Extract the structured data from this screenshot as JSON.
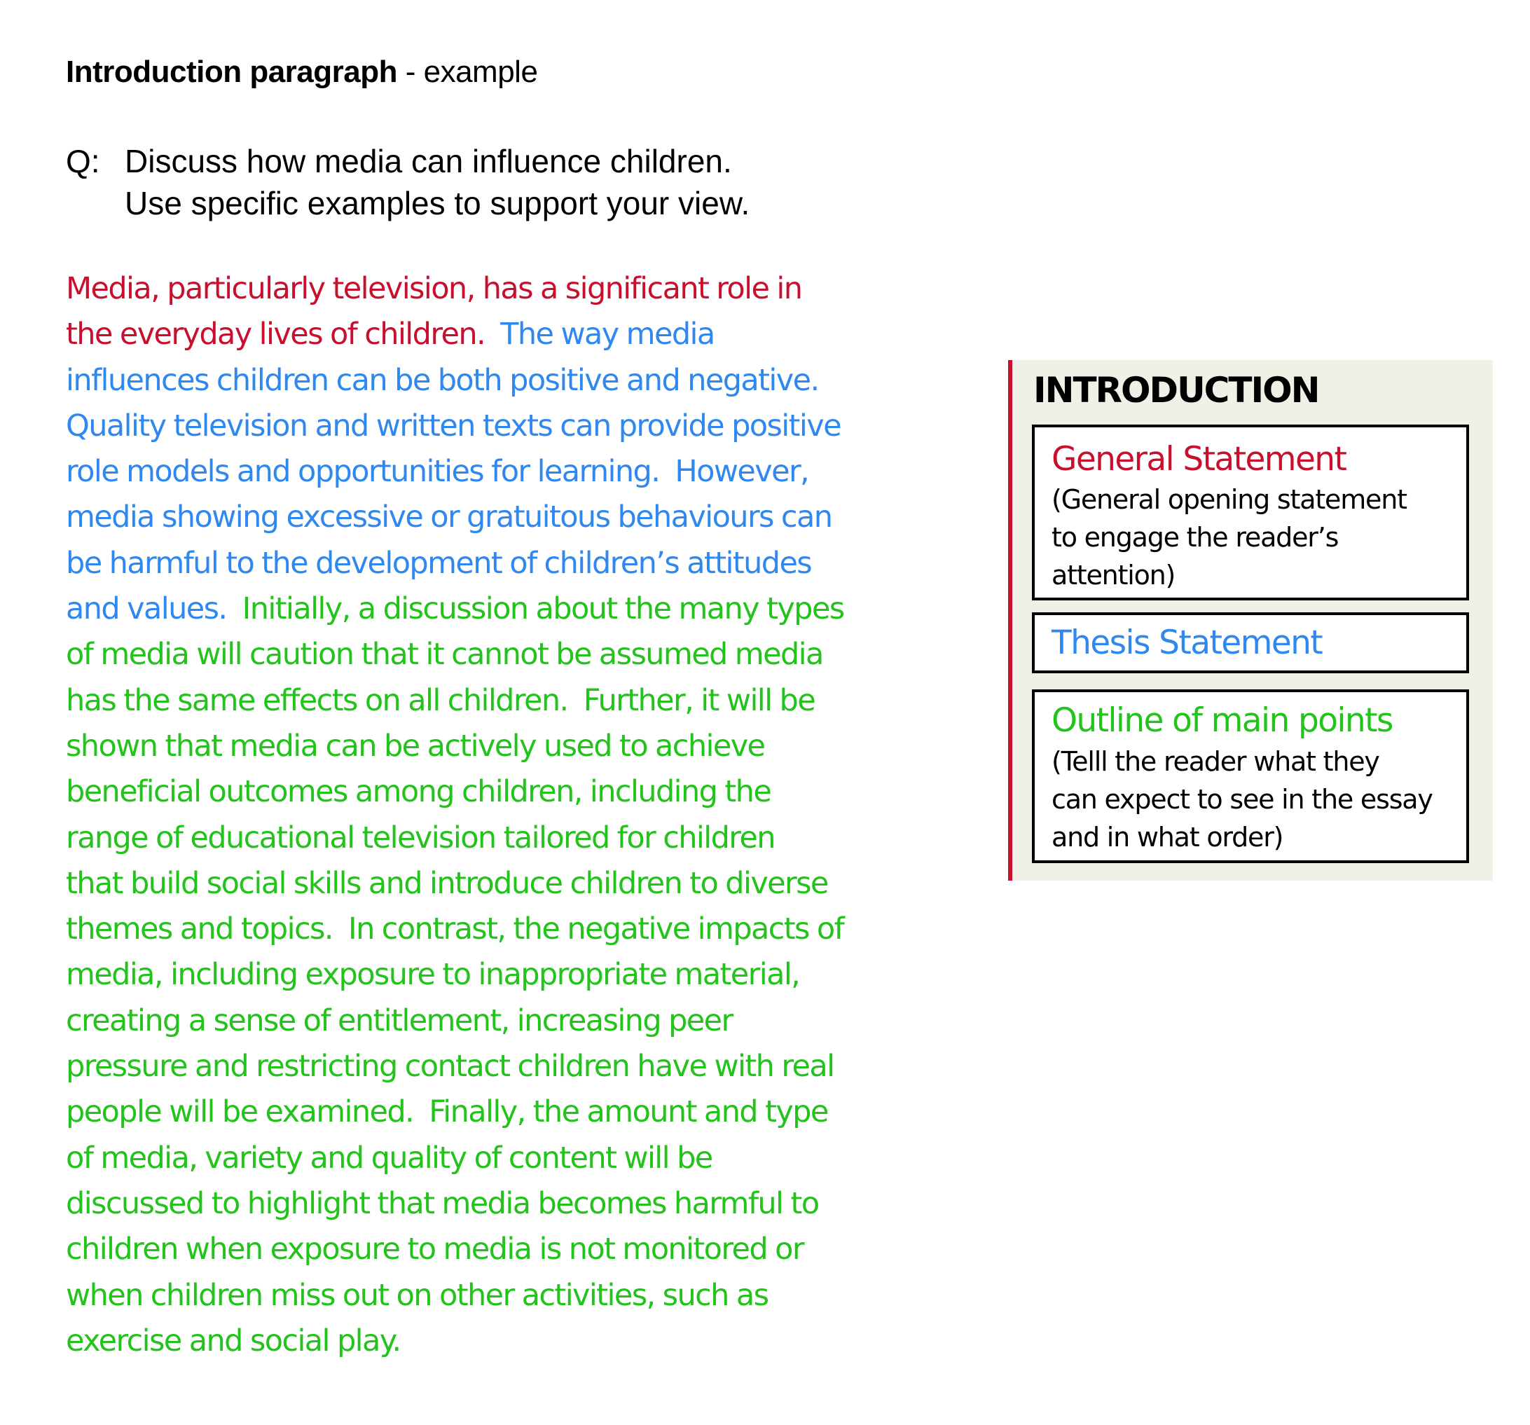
{
  "header": {
    "title_bold": "Introduction paragraph",
    "title_rest": " - example"
  },
  "question": {
    "label": "Q:",
    "line1": "Discuss how media can influence children.",
    "line2": "Use specific examples to support your view."
  },
  "colors": {
    "general_statement": "#c8102e",
    "thesis_statement": "#2f87f0",
    "outline": "#22c31a",
    "panel_background": "#eff1e7",
    "panel_accent_bar": "#c8102e"
  },
  "paragraph": {
    "lines": [
      [
        {
          "role": "general",
          "text": "Media, particularly television, has a significant role in"
        }
      ],
      [
        {
          "role": "general",
          "text": "the everyday lives of children.  "
        },
        {
          "role": "thesis",
          "text": "The way media"
        }
      ],
      [
        {
          "role": "thesis",
          "text": "influences children can be both positive and negative."
        }
      ],
      [
        {
          "role": "thesis",
          "text": "Quality television and written texts can provide positive"
        }
      ],
      [
        {
          "role": "thesis",
          "text": "role models and opportunities for learning.  However,"
        }
      ],
      [
        {
          "role": "thesis",
          "text": "media showing excessive or gratuitous behaviours can"
        }
      ],
      [
        {
          "role": "thesis",
          "text": "be harmful to the development of children’s attitudes"
        }
      ],
      [
        {
          "role": "thesis",
          "text": "and values.  "
        },
        {
          "role": "outline",
          "text": "Initially, a discussion about the many types"
        }
      ],
      [
        {
          "role": "outline",
          "text": "of media will caution that it cannot be assumed media"
        }
      ],
      [
        {
          "role": "outline",
          "text": "has the same effects on all children.  Further, it will be"
        }
      ],
      [
        {
          "role": "outline",
          "text": "shown that media can be actively used to achieve"
        }
      ],
      [
        {
          "role": "outline",
          "text": "beneficial outcomes among children, including the"
        }
      ],
      [
        {
          "role": "outline",
          "text": "range of educational television tailored for children"
        }
      ],
      [
        {
          "role": "outline",
          "text": "that build social skills and introduce children to diverse"
        }
      ],
      [
        {
          "role": "outline",
          "text": "themes and topics.  In contrast, the negative impacts of"
        }
      ],
      [
        {
          "role": "outline",
          "text": "media, including exposure to inappropriate material,"
        }
      ],
      [
        {
          "role": "outline",
          "text": "creating a sense of entitlement, increasing peer"
        }
      ],
      [
        {
          "role": "outline",
          "text": "pressure and restricting contact children have with real"
        }
      ],
      [
        {
          "role": "outline",
          "text": "people will be examined.  Finally, the amount and type"
        }
      ],
      [
        {
          "role": "outline",
          "text": "of media, variety and quality of content will be"
        }
      ],
      [
        {
          "role": "outline",
          "text": "discussed to highlight that media becomes harmful to"
        }
      ],
      [
        {
          "role": "outline",
          "text": "children when exposure to media is not monitored or"
        }
      ],
      [
        {
          "role": "outline",
          "text": "when children miss out on other activities, such as"
        }
      ],
      [
        {
          "role": "outline",
          "text": "exercise and social play."
        }
      ]
    ]
  },
  "panel": {
    "heading": "INTRODUCTION",
    "boxes": [
      {
        "title": "General Statement",
        "role": "general",
        "description": [
          "(General opening statement",
          "to engage the reader’s",
          "attention)"
        ]
      },
      {
        "title": "Thesis Statement",
        "role": "thesis",
        "description": []
      },
      {
        "title": "Outline of main points",
        "role": "outline",
        "description": [
          "(Telll the reader what they",
          "can expect to see in the essay",
          "and in what order)"
        ]
      }
    ]
  }
}
